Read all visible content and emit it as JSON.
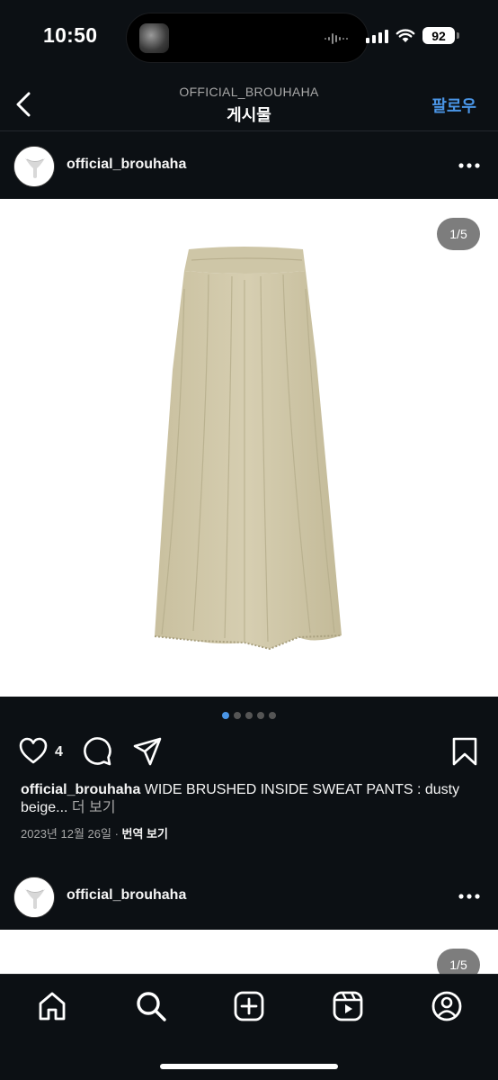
{
  "status_bar": {
    "time": "10:50",
    "battery": "92"
  },
  "header": {
    "account": "OFFICIAL_BROUHAHA",
    "title": "게시물",
    "follow_label": "팔로우"
  },
  "post": {
    "username": "official_brouhaha",
    "image_counter": "1/5",
    "carousel_dots": 5,
    "carousel_active": 1,
    "like_count": "4",
    "caption_user": "official_brouhaha",
    "caption_text": " WIDE BRUSHED INSIDE SWEAT PANTS : dusty beige...",
    "caption_more": " 더 보기",
    "date": "2023년 12월 26일",
    "separator": " · ",
    "translate": "번역 보기"
  },
  "next_post": {
    "username": "official_brouhaha",
    "image_counter": "1/5"
  },
  "icons": {
    "back": "chevron-left-icon",
    "more": "more-horizontal-icon",
    "like": "heart-icon",
    "comment": "comment-icon",
    "share": "send-icon",
    "save": "bookmark-icon",
    "tabs": [
      "home-icon",
      "search-icon",
      "create-icon",
      "reels-icon",
      "profile-icon"
    ]
  },
  "colors": {
    "background": "#0c1014",
    "accent": "#4a95e6",
    "product": "#d5cdb0"
  }
}
